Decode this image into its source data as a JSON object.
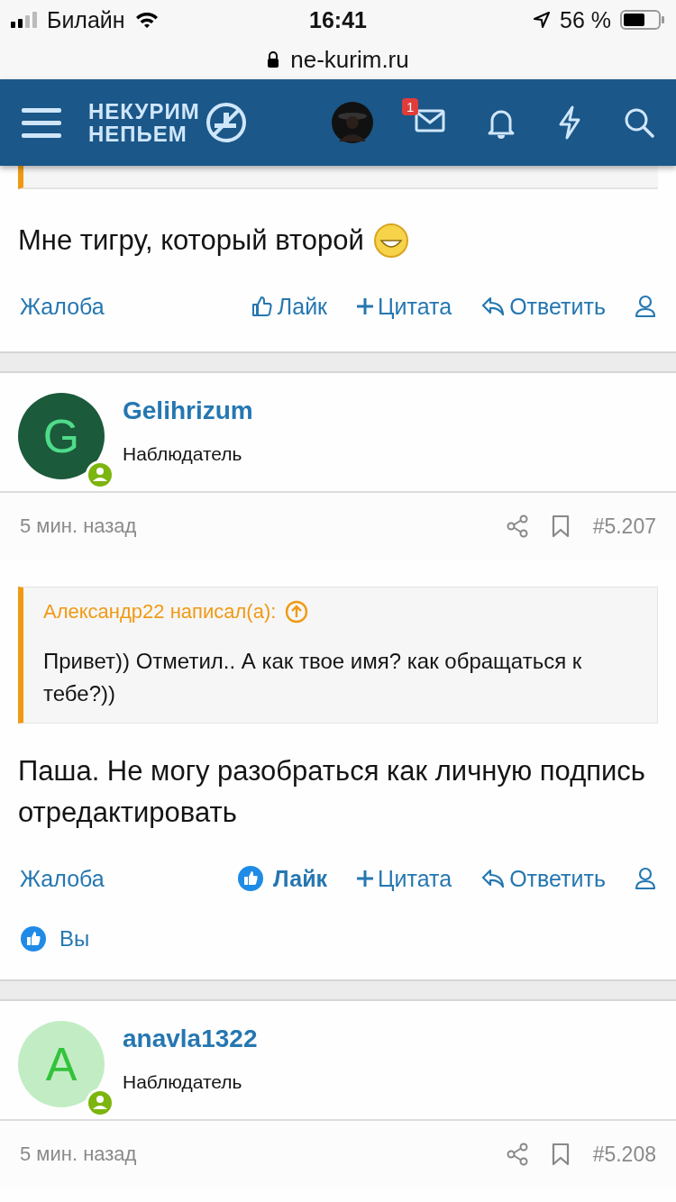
{
  "status_bar": {
    "carrier": "Билайн",
    "time": "16:41",
    "battery": "56 %"
  },
  "browser": {
    "url": "ne-kurim.ru"
  },
  "header": {
    "logo_line_1": "НЕКУРИМ",
    "logo_line_2": "НЕПЬЕМ",
    "mail_badge": "1"
  },
  "posts": [
    {
      "kind": "partial",
      "body": "Мне тигру, который второй",
      "actions": {
        "report": "Жалоба",
        "like": "Лайк",
        "liked": false,
        "quote": "Цитата",
        "reply": "Ответить"
      }
    },
    {
      "kind": "full",
      "author": "Gelihrizum",
      "role": "Наблюдатель",
      "avatar_letter": "G",
      "color": "#1b5a3a",
      "time": "5 мин. назад",
      "number": "#5.207",
      "quote": {
        "author": "Александр22 написал(а):",
        "text": "Привет)) Отметил.. А как твое имя? как обращаться к тебе?))"
      },
      "body": "Паша. Не могу разобраться как личную подпись отредактировать",
      "actions": {
        "report": "Жалоба",
        "like": "Лайк",
        "liked": true,
        "quote": "Цитата",
        "reply": "Ответить"
      },
      "liked_by": "Вы"
    },
    {
      "kind": "head",
      "author": "anavla1322",
      "role": "Наблюдатель",
      "avatar_letter": "A",
      "color": "#c2edc4",
      "time": "5 мин. назад",
      "number": "#5.208"
    }
  ]
}
